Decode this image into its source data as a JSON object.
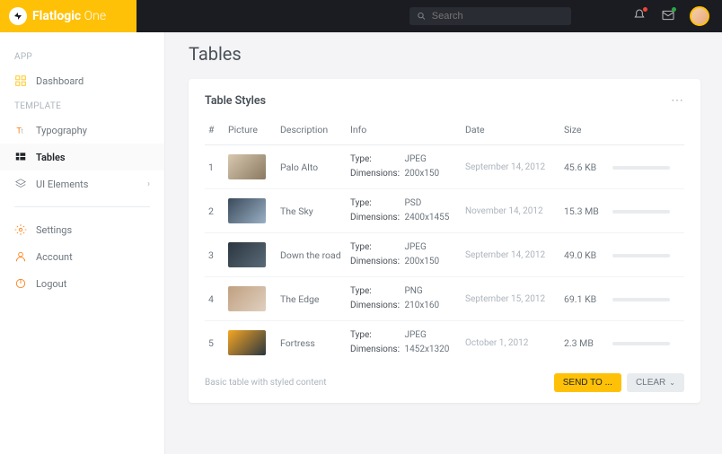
{
  "brand": {
    "first": "Flatlogic",
    "second": "One"
  },
  "search": {
    "placeholder": "Search"
  },
  "sidebar": {
    "section_app": "APP",
    "section_template": "TEMPLATE",
    "dashboard": "Dashboard",
    "typography": "Typography",
    "tables": "Tables",
    "ui_elements": "UI Elements",
    "settings": "Settings",
    "account": "Account",
    "logout": "Logout"
  },
  "page": {
    "title": "Tables"
  },
  "card": {
    "title": "Table Styles",
    "footer_note": "Basic table with styled content",
    "send_label": "SEND TO ...",
    "clear_label": "CLEAR"
  },
  "columns": {
    "num": "#",
    "picture": "Picture",
    "description": "Description",
    "info": "Info",
    "date": "Date",
    "size": "Size"
  },
  "labels": {
    "type": "Type:",
    "dimensions": "Dimensions:"
  },
  "rows": [
    {
      "num": "1",
      "desc": "Palo Alto",
      "type": "JPEG",
      "dim": "200x150",
      "date": "September 14, 2012",
      "size": "45.6 KB"
    },
    {
      "num": "2",
      "desc": "The Sky",
      "type": "PSD",
      "dim": "2400x1455",
      "date": "November 14, 2012",
      "size": "15.3 MB"
    },
    {
      "num": "3",
      "desc": "Down the road",
      "type": "JPEG",
      "dim": "200x150",
      "date": "September 14, 2012",
      "size": "49.0 KB"
    },
    {
      "num": "4",
      "desc": "The Edge",
      "type": "PNG",
      "dim": "210x160",
      "date": "September 15, 2012",
      "size": "69.1 KB"
    },
    {
      "num": "5",
      "desc": "Fortress",
      "type": "JPEG",
      "dim": "1452x1320",
      "date": "October 1, 2012",
      "size": "2.3 MB"
    }
  ]
}
